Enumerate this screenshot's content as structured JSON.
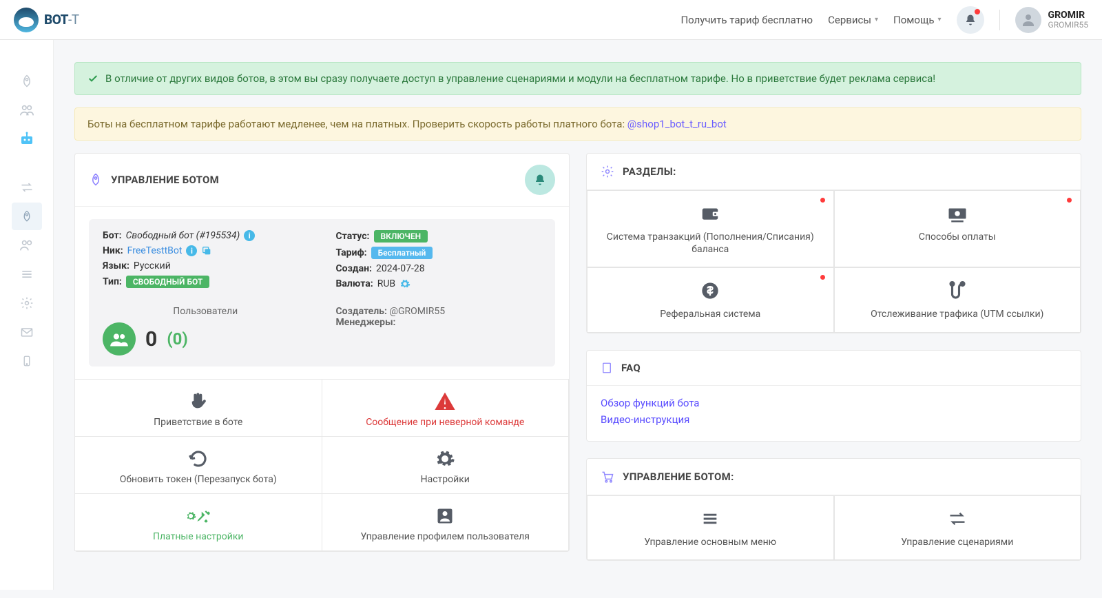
{
  "header": {
    "logo_main": "BOT",
    "logo_suffix": "-T",
    "nav": {
      "free_tariff": "Получить тариф бесплатно",
      "services": "Сервисы",
      "help": "Помощь"
    },
    "user": {
      "name": "GROMIR",
      "sub": "GROMIR55"
    }
  },
  "alerts": {
    "success": "В отличие от других видов ботов, в этом вы сразу получаете доступ в управление сценариями и модули на бесплатном тарифе. Но в приветствие будет реклама сервиса!",
    "warning_text": "Боты на бесплатном тарифе работают медленее, чем на платных. Проверить скорость работы платного бота: ",
    "warning_link": "@shop1_bot_t_ru_bot"
  },
  "bot_panel": {
    "title": "УПРАВЛЕНИЕ БОТОМ",
    "labels": {
      "bot": "Бот:",
      "nick": "Ник:",
      "lang": "Язык:",
      "type": "Тип:",
      "status": "Статус:",
      "tariff": "Тариф:",
      "created": "Создан:",
      "currency": "Валюта:",
      "users": "Пользователи",
      "creator": "Создатель:",
      "managers": "Менеджеры:"
    },
    "values": {
      "bot_name": "Свободный бот (#195534)",
      "nick": "FreeTesttBot",
      "lang": "Русский",
      "type_badge": "СВОБОДНЫЙ БОТ",
      "status_badge": "ВКЛЮЧЕН",
      "tariff_badge": "Бесплатный",
      "created": "2024-07-28",
      "currency": "RUB",
      "creator": "@GROMIR55",
      "users_count": "0",
      "users_paren": "(0)"
    },
    "tiles": [
      {
        "label": "Приветствие в боте"
      },
      {
        "label": "Сообщение при неверной команде"
      },
      {
        "label": "Обновить токен (Перезапуск бота)"
      },
      {
        "label": "Настройки"
      },
      {
        "label": "Платные настройки"
      },
      {
        "label": "Управление профилем пользователя"
      }
    ]
  },
  "sections_panel": {
    "title": "РАЗДЕЛЫ:",
    "tiles": [
      {
        "label": "Система транзакций (Пополнения/Списания) баланса",
        "dot": true
      },
      {
        "label": "Способы оплаты",
        "dot": true
      },
      {
        "label": "Реферальная система",
        "dot": true
      },
      {
        "label": "Отслеживание трафика (UTM ссылки)",
        "dot": false
      }
    ]
  },
  "faq_panel": {
    "title": "FAQ",
    "links": [
      "Обзор функций бота",
      "Видео-инструкция"
    ]
  },
  "manage_panel": {
    "title": "УПРАВЛЕНИЕ БОТОМ:",
    "tiles": [
      {
        "label": "Управление основным меню"
      },
      {
        "label": "Управление сценариями"
      }
    ]
  }
}
